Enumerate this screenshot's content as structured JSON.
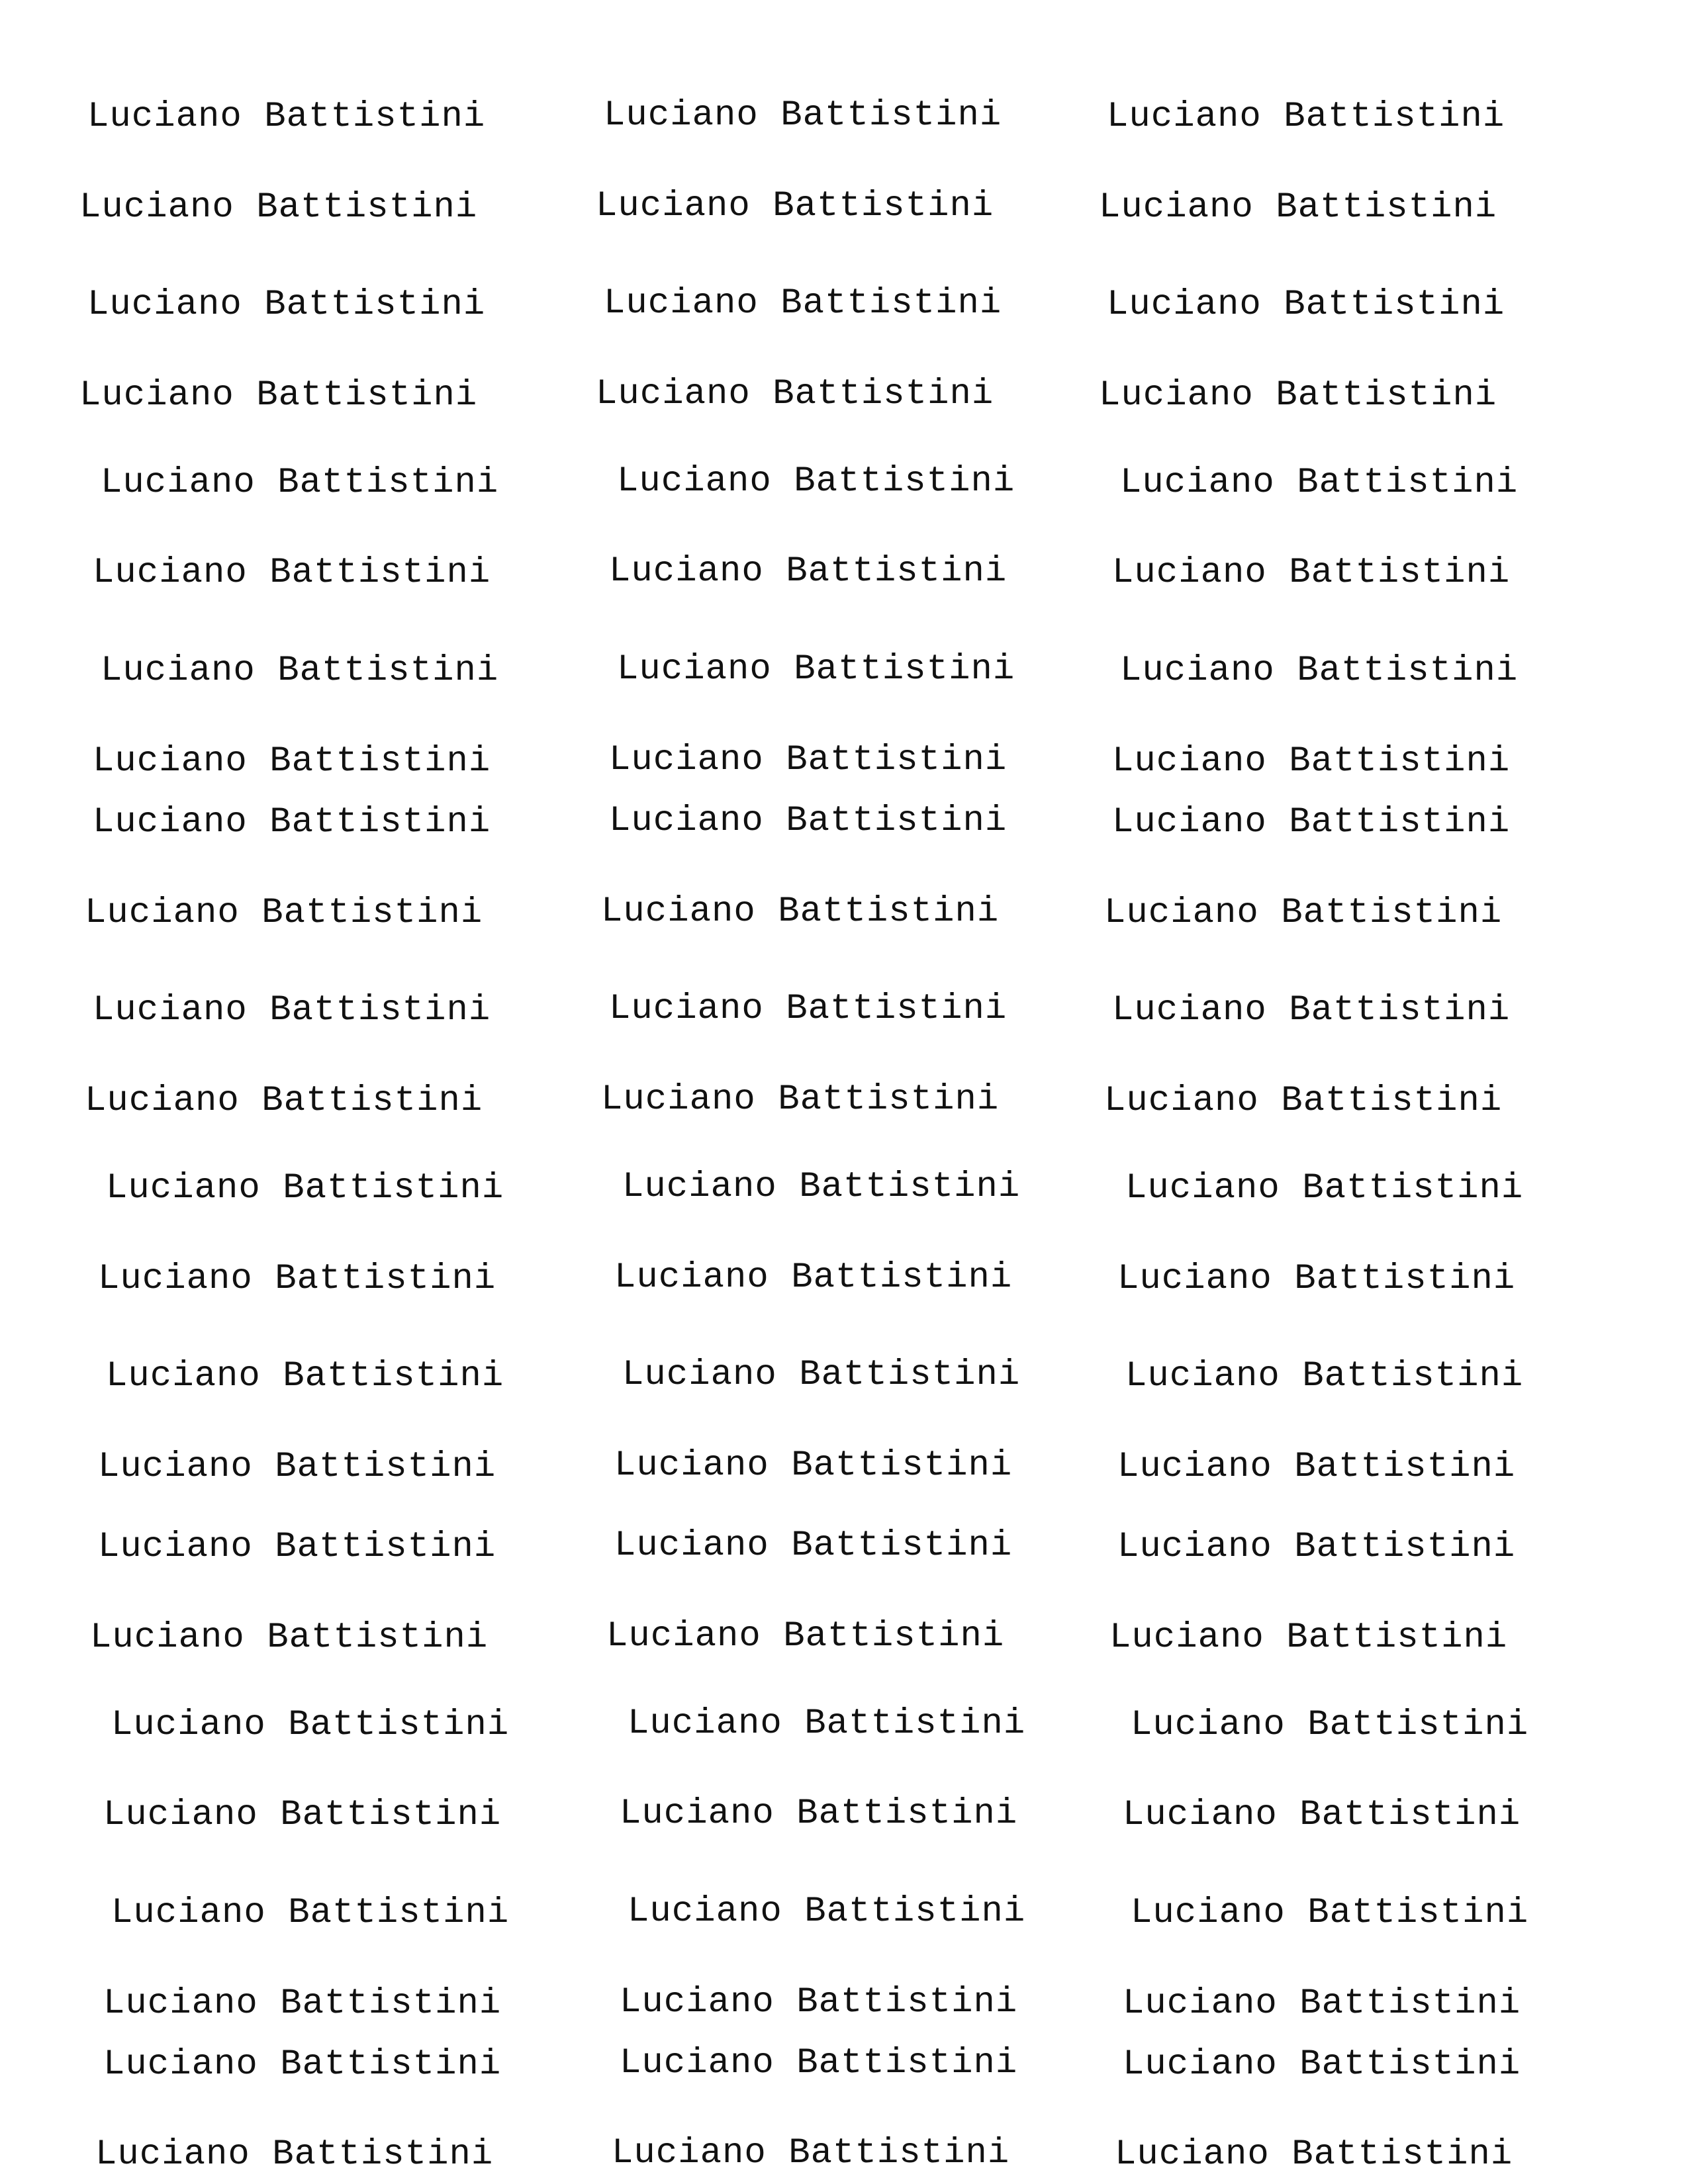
{
  "sheet": {
    "rows": [
      [
        "Luciano Battistini",
        "Luciano Battistini",
        "Luciano Battistini"
      ],
      [
        "Luciano Battistini",
        "Luciano Battistini",
        "Luciano Battistini"
      ],
      [
        "Luciano Battistini",
        "Luciano Battistini",
        "Luciano Battistini"
      ],
      [
        "Luciano Battistini",
        "Luciano Battistini",
        "Luciano Battistini"
      ],
      [
        "Luciano Battistini",
        "Luciano Battistini",
        "Luciano Battistini"
      ],
      [
        "Luciano Battistini",
        "Luciano Battistini",
        "Luciano Battistini"
      ],
      [
        "Luciano Battistini",
        "Luciano Battistini",
        "Luciano Battistini"
      ],
      [
        "Luciano Battistini",
        "Luciano Battistini",
        "Luciano Battistini"
      ],
      [
        "Luciano Battistini",
        "Luciano Battistini",
        "Luciano Battistini"
      ],
      [
        "Luciano Battistini",
        "Luciano Battistini",
        "Luciano Battistini"
      ],
      [
        "Luciano Battistini",
        "Luciano Battistini",
        "Luciano Battistini"
      ],
      [
        "Luciano Battistini",
        "Luciano Battistini",
        "Luciano Battistini"
      ],
      [
        "Luciano Battistini",
        "Luciano Battistini",
        "Luciano Battistini"
      ],
      [
        "Luciano Battistini",
        "Luciano Battistini",
        "Luciano Battistini"
      ],
      [
        "Luciano Battistini",
        "Luciano Battistini",
        "Luciano Battistini"
      ],
      [
        "Luciano Battistini",
        "Luciano Battistini",
        "Luciano Battistini"
      ],
      [
        "Luciano Battistini",
        "Luciano Battistini",
        "Luciano Battistini"
      ],
      [
        "Luciano Battistini",
        "Luciano Battistini",
        "Luciano Battistini"
      ],
      [
        "Luciano Battistini",
        "Luciano Battistini",
        "Luciano Battistini"
      ],
      [
        "Luciano Battistini",
        "Luciano Battistini",
        "Luciano Battistini"
      ],
      [
        "Luciano Battistini",
        "Luciano Battistini",
        "Luciano Battistini"
      ],
      [
        "Luciano Battistini",
        "Luciano Battistini",
        "Luciano Battistini"
      ],
      [
        "Luciano Battistini",
        "Luciano Battistini",
        "Luciano Battistini"
      ],
      [
        "Luciano Battistini",
        "Luciano Battistini",
        "Luciano Battistini"
      ]
    ]
  }
}
